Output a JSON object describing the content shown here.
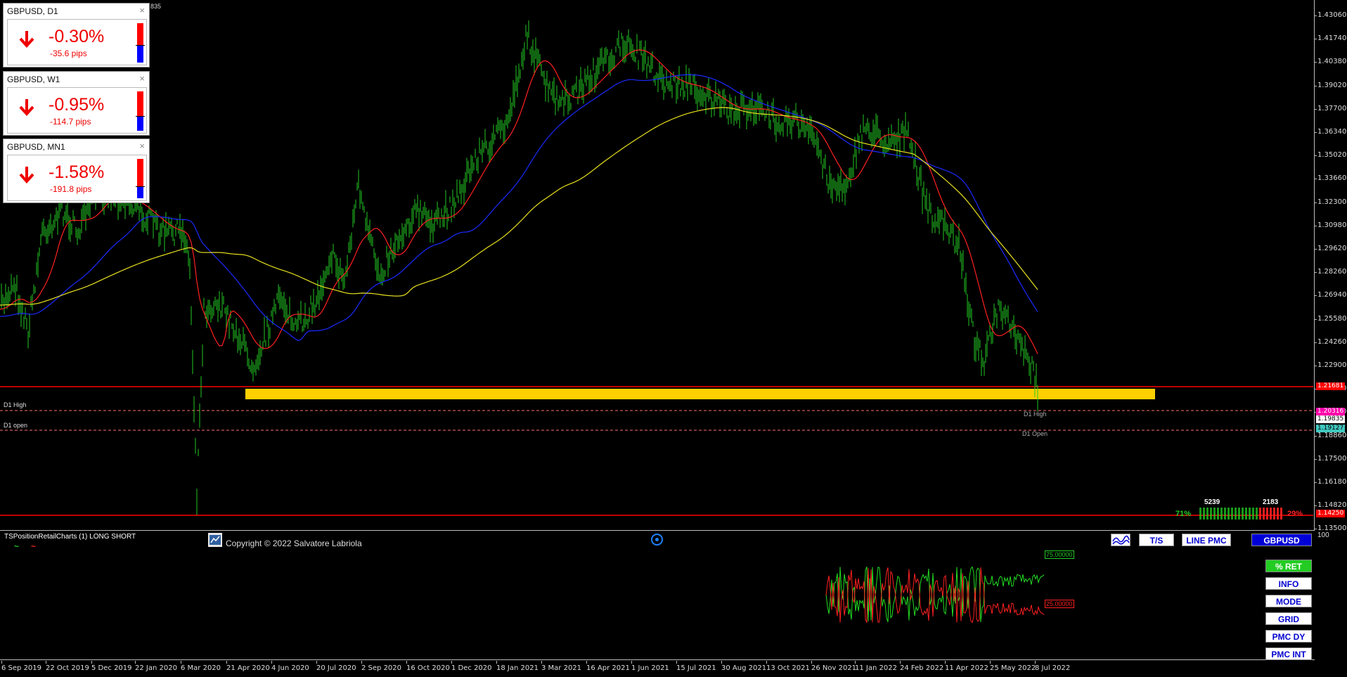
{
  "panels": [
    {
      "title": "GBPUSD, D1",
      "close": "×",
      "percent": "-0.30%",
      "pips": "-35.6 pips",
      "red_fraction": 0.55
    },
    {
      "title": "GBPUSD, W1",
      "close": "×",
      "percent": "-0.95%",
      "pips": "-114.7 pips",
      "red_fraction": 0.62
    },
    {
      "title": "GBPUSD, MN1",
      "close": "×",
      "percent": "-1.58%",
      "pips": "-191.8 pips",
      "red_fraction": 0.7
    }
  ],
  "corner_label": "835",
  "price_axis": {
    "ticks": [
      "1.43060",
      "1.41740",
      "1.40380",
      "1.39020",
      "1.37700",
      "1.36340",
      "1.35020",
      "1.33660",
      "1.32300",
      "1.30980",
      "1.29620",
      "1.28260",
      "1.26940",
      "1.25580",
      "1.24260",
      "1.22900",
      "1.21580",
      "1.20220",
      "1.18860",
      "1.17500",
      "1.16180",
      "1.14820",
      "1.13500"
    ],
    "tags": [
      {
        "text": "1.21681",
        "bg": "#ff0000",
        "color": "#ffffff"
      },
      {
        "text": "1.20316",
        "bg": "#ff00aa",
        "color": "#ffffff"
      },
      {
        "text": "1.19835",
        "bg": "#ffffff",
        "color": "#000000"
      },
      {
        "text": "1.19127",
        "bg": "#40c8c0",
        "color": "#000000"
      },
      {
        "text": "1.14250",
        "bg": "#ff0000",
        "color": "#ffffff"
      }
    ]
  },
  "lines": {
    "d1_high_left": "D1 High",
    "d1_open_left": "D1 open",
    "d1_high_right": "D1 High",
    "d1_open_right": "D1 Open"
  },
  "sentiment": {
    "long_count": "5239",
    "short_count": "2183",
    "long_pct": "71%",
    "short_pct": "29%",
    "long_color": "#22cc22",
    "short_color": "#ff2020"
  },
  "sub_window": {
    "indicator_title": "TSPositionRetailCharts (1) LONG SHORT",
    "copyright": "Copyright © 2022 Salvatore Labriola",
    "axis_top": "100",
    "long_value": "75.00000",
    "short_value": "25.00000",
    "buttons_top": [
      "T/S",
      "LINE PMC",
      "GBPUSD"
    ],
    "buttons_side": [
      "% RET",
      "INFO",
      "MODE",
      "GRID",
      "PMC DY",
      "PMC INT"
    ]
  },
  "dates": [
    "6 Sep 2019",
    "22 Oct 2019",
    "5 Dec 2019",
    "22 Jan 2020",
    "6 Mar 2020",
    "21 Apr 2020",
    "4 Jun 2020",
    "20 Jul 2020",
    "2 Sep 2020",
    "16 Oct 2020",
    "1 Dec 2020",
    "18 Jan 2021",
    "3 Mar 2021",
    "16 Apr 2021",
    "1 Jun 2021",
    "15 Jul 2021",
    "30 Aug 2021",
    "13 Oct 2021",
    "26 Nov 2021",
    "11 Jan 2022",
    "24 Feb 2022",
    "11 Apr 2022",
    "25 May 2022",
    "8 Jul 2022"
  ],
  "colors": {
    "candles": "#22c822",
    "ma_fast": "#ff2020",
    "ma_mid": "#1a2aff",
    "ma_slow": "#e8e020",
    "zone": "#ffd000",
    "level": "#ff0000"
  }
}
